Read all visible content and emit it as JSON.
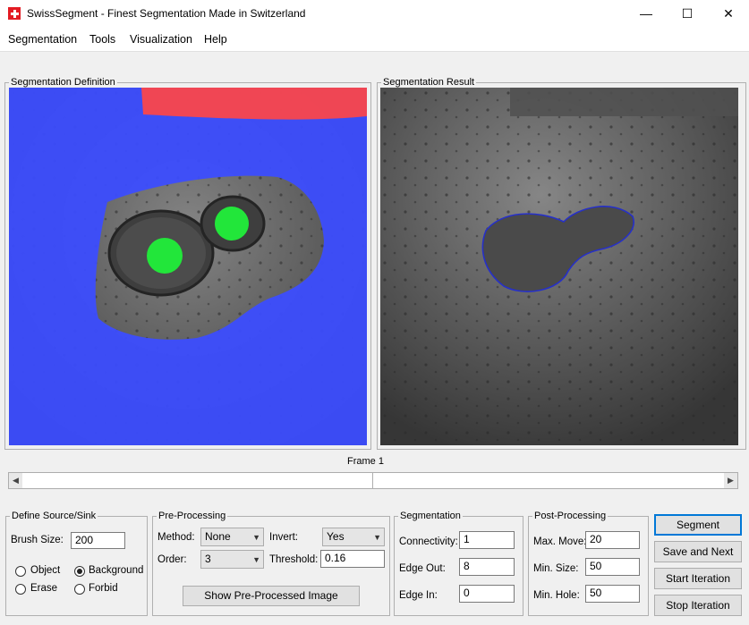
{
  "window": {
    "title": "SwissSegment - Finest Segmentation Made in Switzerland",
    "minimize": "—",
    "maximize": "☐",
    "close": "✕"
  },
  "menu": [
    "Segmentation",
    "Tools",
    "Visualization",
    "Help"
  ],
  "panels": {
    "definition_title": "Segmentation Definition",
    "result_title": "Segmentation Result"
  },
  "frame": {
    "label": "Frame 1",
    "position": 0.5
  },
  "source_sink": {
    "title": "Define Source/Sink",
    "brush_size_label": "Brush Size:",
    "brush_size": "200",
    "options": [
      {
        "label": "Object",
        "checked": false
      },
      {
        "label": "Background",
        "checked": true
      },
      {
        "label": "Erase",
        "checked": false
      },
      {
        "label": "Forbid",
        "checked": false
      }
    ]
  },
  "preprocessing": {
    "title": "Pre-Processing",
    "method_label": "Method:",
    "method": "None",
    "invert_label": "Invert:",
    "invert": "Yes",
    "order_label": "Order:",
    "order": "3",
    "threshold_label": "Threshold:",
    "threshold": "0.16",
    "show_button": "Show Pre-Processed Image"
  },
  "segmentation": {
    "title": "Segmentation",
    "connectivity_label": "Connectivity:",
    "connectivity": "1",
    "edge_out_label": "Edge Out:",
    "edge_out": "8",
    "edge_in_label": "Edge In:",
    "edge_in": "0"
  },
  "postprocessing": {
    "title": "Post-Processing",
    "max_move_label": "Max. Move:",
    "max_move": "20",
    "min_size_label": "Min. Size:",
    "min_size": "50",
    "min_hole_label": "Min. Hole:",
    "min_hole": "50"
  },
  "buttons": {
    "segment": "Segment",
    "save_next": "Save and Next",
    "start": "Start Iteration",
    "stop": "Stop Iteration"
  },
  "colors": {
    "background_mask": "#3b4dff",
    "object_mask": "#22e63a",
    "sink_mask": "#ff4040",
    "contour": "#2630c8"
  }
}
